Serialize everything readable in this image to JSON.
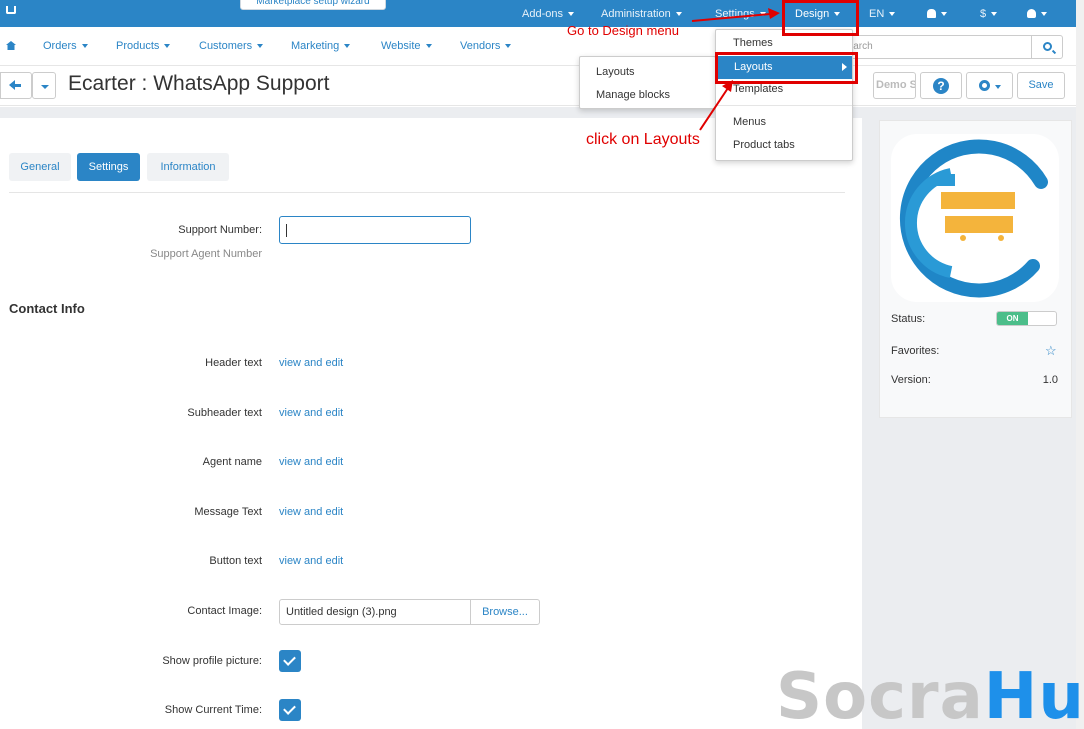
{
  "topbar": {
    "wizard": "Marketplace setup wizard",
    "items": [
      {
        "label": "Add-ons"
      },
      {
        "label": "Administration"
      },
      {
        "label": "Settings"
      },
      {
        "label": "Design"
      },
      {
        "label": "EN"
      },
      {
        "label": "$"
      }
    ]
  },
  "mainnav": {
    "items": [
      "Orders",
      "Products",
      "Customers",
      "Marketing",
      "Website",
      "Vendors"
    ],
    "search_placeholder": "Search"
  },
  "titlebar": {
    "title": "Ecarter : WhatsApp Support",
    "demo_label": "Demo Sto",
    "save_label": "Save"
  },
  "tabs": [
    "General",
    "Settings",
    "Information"
  ],
  "form": {
    "support_number_label": "Support Number:",
    "support_number_help": "Support Agent Number",
    "section_title": "Contact Info",
    "text_fields": [
      {
        "label": "Header text",
        "link": "view and edit"
      },
      {
        "label": "Subheader text",
        "link": "view and edit"
      },
      {
        "label": "Agent name",
        "link": "view and edit"
      },
      {
        "label": "Message Text",
        "link": "view and edit"
      },
      {
        "label": "Button text",
        "link": "view and edit"
      }
    ],
    "contact_image_label": "Contact Image:",
    "contact_image_value": "Untitled design (3).png",
    "browse_label": "Browse...",
    "show_profile_label": "Show profile picture:",
    "show_time_label": "Show Current Time:"
  },
  "addon": {
    "status_label": "Status:",
    "status_value": "ON",
    "favorites_label": "Favorites:",
    "version_label": "Version:",
    "version_value": "1.0"
  },
  "design_menu": {
    "items": [
      "Themes",
      "Layouts",
      "Templates",
      "Menus",
      "Product tabs"
    ]
  },
  "layouts_submenu": {
    "items": [
      "Layouts",
      "Manage blocks"
    ]
  },
  "annotations": {
    "design_note": "Go to Design menu",
    "layouts_note": "click on Layouts"
  },
  "watermark": {
    "part1": "Socra",
    "part2": "Hub"
  },
  "colors": {
    "primary": "#2b85c6",
    "annotation": "#e00000",
    "on_toggle": "#4cbe8a"
  }
}
